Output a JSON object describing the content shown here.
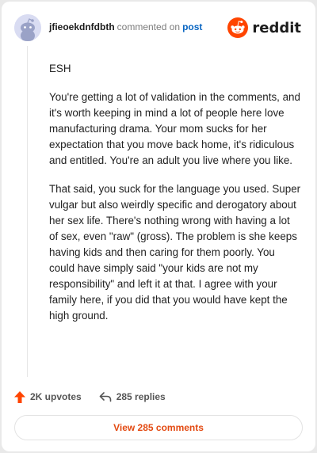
{
  "comment": {
    "username": "jfieoekdnfdbth",
    "action_text": "commented on",
    "post_link": "post",
    "paragraphs": [
      "ESH",
      "You're getting a lot of validation in the comments, and it's worth keeping in mind a lot of people here love manufacturing drama. Your mom sucks for her expectation that you move back home, it's ridiculous and entitled. You're an adult you live where you like.",
      "That said, you suck for the language you used. Super vulgar but also weirdly specific and derogatory about her sex life. There's nothing wrong with having a lot of sex, even \"raw\" (gross). The problem is she keeps having kids and then caring for them poorly. You could have simply said \"your kids are not my responsibility\" and left it at that. I agree with your family here, if you did that you would have kept the high ground."
    ],
    "upvotes_label": "2K upvotes",
    "replies_label": "285 replies",
    "view_comments_label": "View 285 comments"
  },
  "brand": {
    "wordmark": "reddit",
    "logo_icon": "reddit-snoo-icon",
    "accent_color": "#ff4500"
  },
  "icons": {
    "avatar": "default-snoo-avatar-icon",
    "upvote": "upvote-arrow-icon",
    "reply": "reply-arrow-icon"
  },
  "colors": {
    "link": "#0a66c2",
    "view_button_text": "#e34a12",
    "upvote": "#ff4500"
  }
}
